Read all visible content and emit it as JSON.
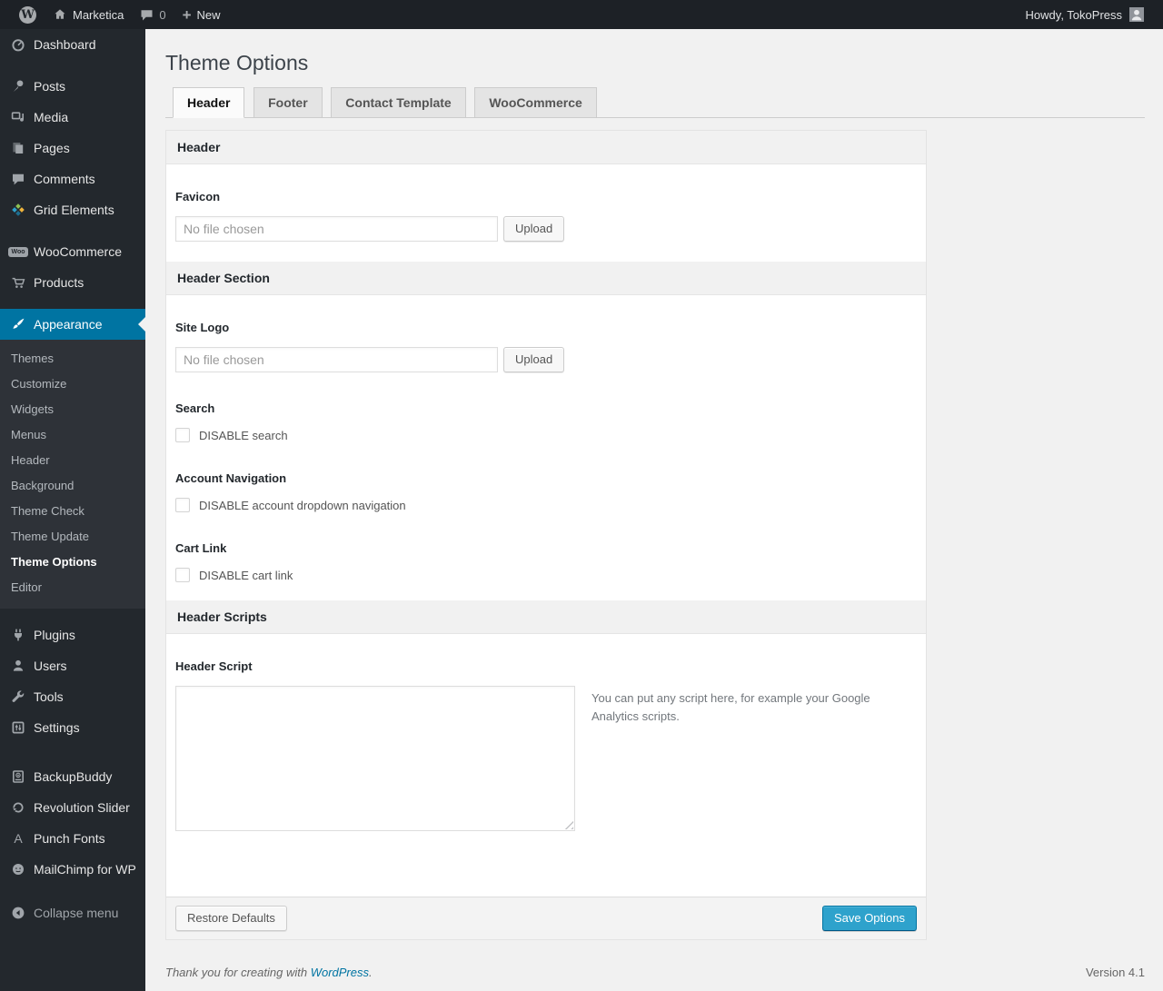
{
  "colors": {
    "accent": "#0074a2",
    "primary_button": "#2ea2cc",
    "menu_bg": "#23282d",
    "submenu_bg": "#2e3238"
  },
  "admin_bar": {
    "wp_logo_letter": "W",
    "site_name": "Marketica",
    "comment_count": "0",
    "plus_glyph": "+",
    "new_label": "New",
    "howdy": "Howdy, TokoPress"
  },
  "sidebar": {
    "items": [
      {
        "label": "Dashboard",
        "icon": "dashboard-icon"
      },
      {
        "label": "Posts",
        "icon": "pushpin-icon"
      },
      {
        "label": "Media",
        "icon": "media-icon"
      },
      {
        "label": "Pages",
        "icon": "pages-icon"
      },
      {
        "label": "Comments",
        "icon": "comments-icon"
      },
      {
        "label": "Grid Elements",
        "icon": "grid-elements-icon"
      },
      {
        "label": "WooCommerce",
        "icon": "woocommerce-icon"
      },
      {
        "label": "Products",
        "icon": "cart-icon"
      },
      {
        "label": "Appearance",
        "icon": "brush-icon",
        "current": true
      },
      {
        "label": "Plugins",
        "icon": "plug-icon"
      },
      {
        "label": "Users",
        "icon": "person-icon"
      },
      {
        "label": "Tools",
        "icon": "wrench-icon"
      },
      {
        "label": "Settings",
        "icon": "sliders-icon"
      },
      {
        "label": "BackupBuddy",
        "icon": "backup-disk-icon"
      },
      {
        "label": "Revolution Slider",
        "icon": "refresh-icon"
      },
      {
        "label": "Punch Fonts",
        "icon": "letter-a-icon"
      },
      {
        "label": "MailChimp for WP",
        "icon": "monkey-icon"
      }
    ],
    "woo_badge": "Woo",
    "punch_fonts_glyph": "A",
    "appearance_submenu": [
      "Themes",
      "Customize",
      "Widgets",
      "Menus",
      "Header",
      "Background",
      "Theme Check",
      "Theme Update",
      "Theme Options",
      "Editor"
    ],
    "collapse_label": "Collapse menu"
  },
  "page": {
    "title": "Theme Options"
  },
  "tabs": [
    {
      "label": "Header",
      "active": true
    },
    {
      "label": "Footer",
      "active": false
    },
    {
      "label": "Contact Template",
      "active": false
    },
    {
      "label": "WooCommerce",
      "active": false
    }
  ],
  "panel": {
    "sections": [
      {
        "title": "Header"
      },
      {
        "title": "Header Section"
      },
      {
        "title": "Header Scripts"
      }
    ],
    "favicon": {
      "label": "Favicon",
      "value": "No file chosen",
      "button": "Upload"
    },
    "site_logo": {
      "label": "Site Logo",
      "value": "No file chosen",
      "button": "Upload"
    },
    "search": {
      "label": "Search",
      "checkbox": "DISABLE search",
      "checked": false
    },
    "account_nav": {
      "label": "Account Navigation",
      "checkbox": "DISABLE account dropdown navigation",
      "checked": false
    },
    "cart_link": {
      "label": "Cart Link",
      "checkbox": "DISABLE cart link",
      "checked": false
    },
    "header_script": {
      "label": "Header Script",
      "value": "",
      "hint": "You can put any script here, for example your Google Analytics scripts."
    },
    "footer": {
      "restore_label": "Restore Defaults",
      "save_label": "Save Options"
    }
  },
  "page_footer": {
    "thanks_text": "Thank you for creating with ",
    "wordpress_link": "WordPress",
    "period": ".",
    "version": "Version 4.1"
  }
}
